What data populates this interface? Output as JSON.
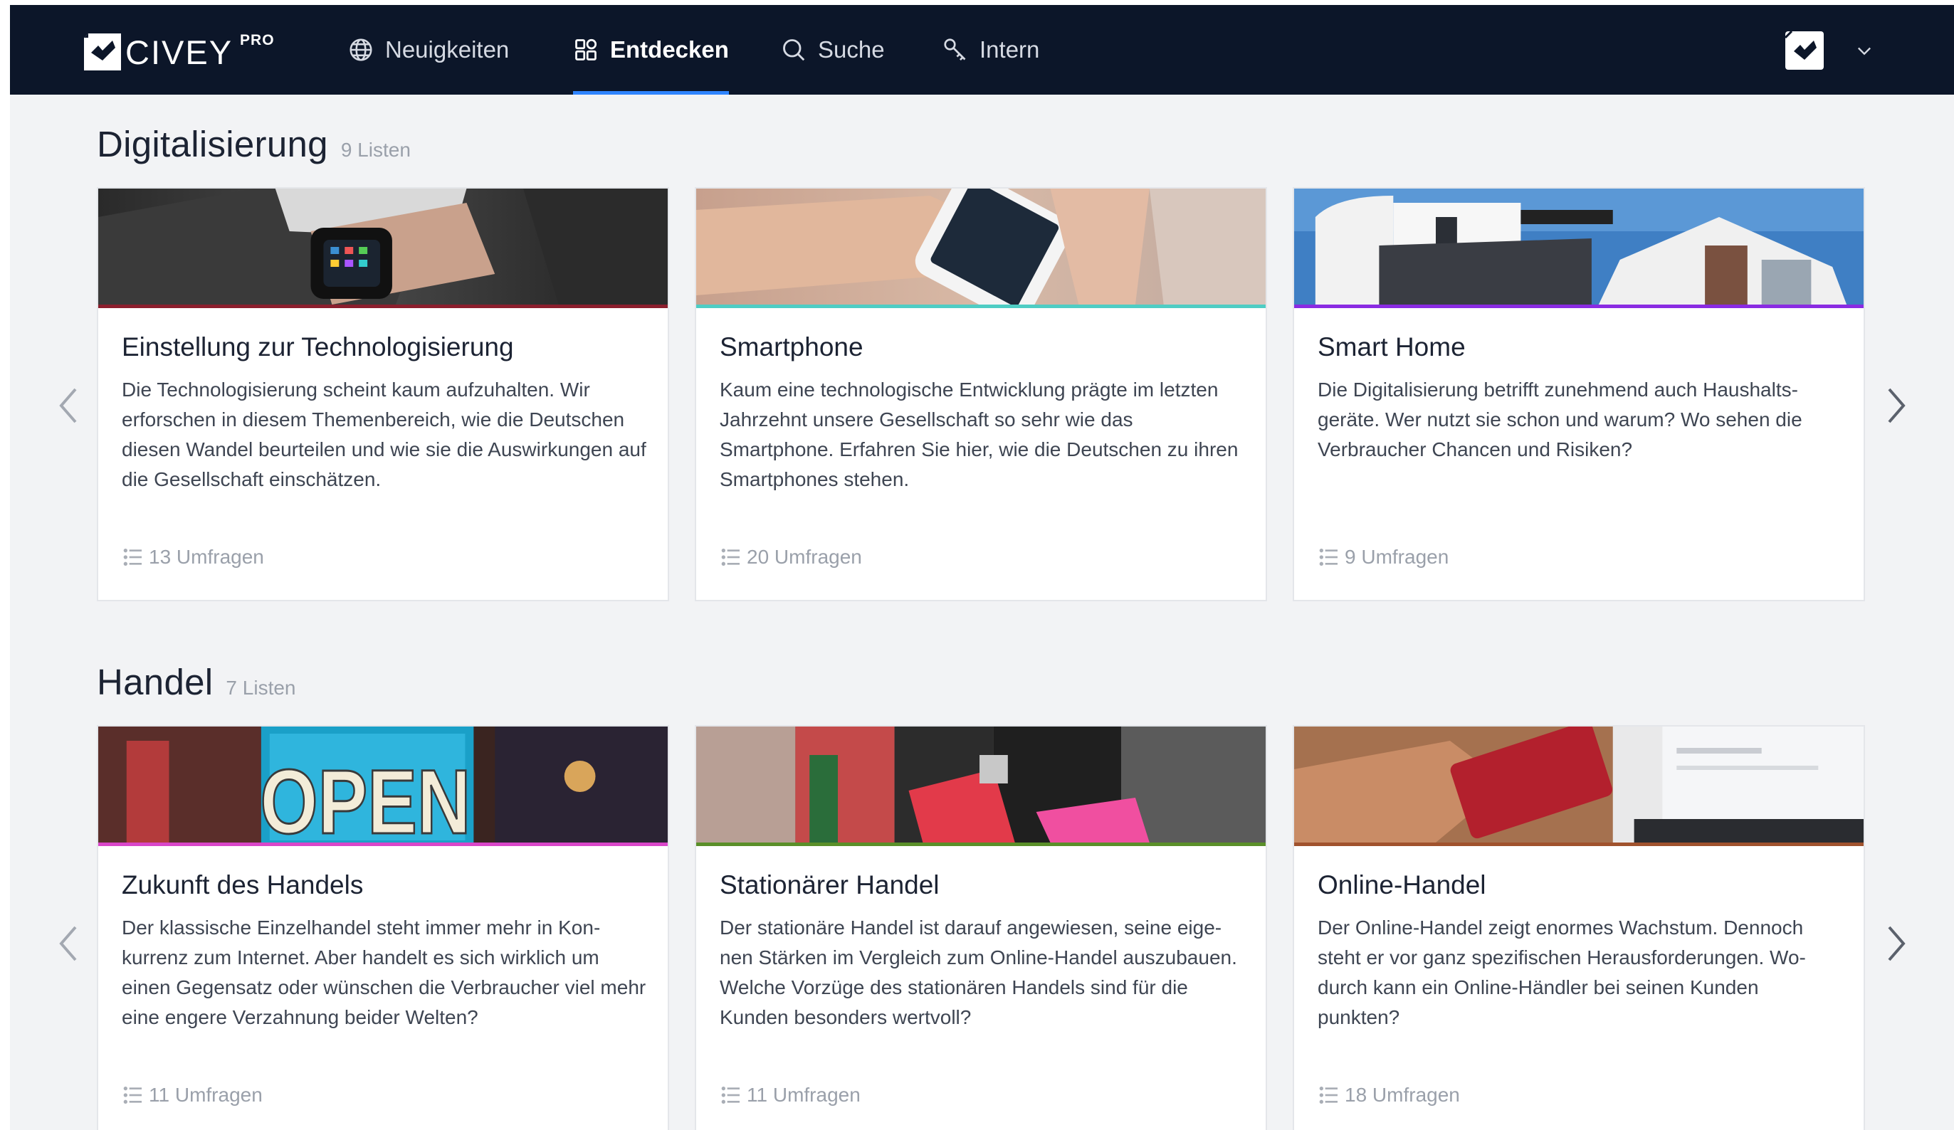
{
  "brand": {
    "name": "CIVEY",
    "badge": "PRO"
  },
  "nav": {
    "items": [
      {
        "label": "Neuigkeiten",
        "icon": "globe-icon"
      },
      {
        "label": "Entdecken",
        "icon": "grid-icon",
        "active": true
      },
      {
        "label": "Suche",
        "icon": "search-icon"
      },
      {
        "label": "Intern",
        "icon": "key-icon"
      }
    ],
    "accent": "#2f84ff"
  },
  "sections": [
    {
      "title": "Digitalisierung",
      "count": "9 Listen",
      "cards": [
        {
          "title": "Einstellung zur Technologisierung",
          "description": "Die Technologisierung scheint kaum aufzuhalten. Wir erforschen in diesem Themenbereich, wie die Deut­schen diesen Wandel beurteilen und wie sie die Auswir­kungen auf die Gesellschaft einschätzen.",
          "surveys": "13 Umfragen",
          "accent": "#8b1e2d",
          "image": "smartwatch-photo"
        },
        {
          "title": "Smartphone",
          "description": "Kaum eine technologische Entwicklung prägte im letz­ten Jahrzehnt unsere Gesellschaft so sehr wie das Smartphone. Erfahren Sie hier, wie die Deutschen zu ih­ren Smartphones stehen.",
          "surveys": "20 Umfragen",
          "accent": "#4ecdc4",
          "image": "smartphone-photo"
        },
        {
          "title": "Smart Home",
          "description": "Die Digitalisierung betrifft zunehmend auch Haushalts­geräte. Wer nutzt sie schon und warum? Wo sehen die Verbraucher Chancen und Risiken?",
          "surveys": "9 Umfragen",
          "accent": "#8a2be2",
          "image": "house-photo"
        }
      ]
    },
    {
      "title": "Handel",
      "count": "7 Listen",
      "cards": [
        {
          "title": "Zukunft des Handels",
          "description": "Der klassische Einzelhandel steht immer mehr in Kon­kurrenz zum Internet. Aber handelt es sich wirklich um einen Gegensatz oder wünschen die Verbraucher viel mehr eine engere Verzahnung beider Welten?",
          "surveys": "11 Umfragen",
          "accent": "#d946c9",
          "image": "open-sign-photo",
          "sign": "OPEN"
        },
        {
          "title": "Stationärer Handel",
          "description": "Der stationäre Handel ist darauf angewiesen, seine eige­nen Stärken im Vergleich zum Online-Handel auszubau­en. Welche Vorzüge des stationären Handels sind für die Kunden besonders wertvoll?",
          "surveys": "11 Umfragen",
          "accent": "#5a8f29",
          "image": "shopping-bags-photo"
        },
        {
          "title": "Online-Handel",
          "description": "Der Online-Handel zeigt enormes Wachstum. Dennoch steht er vor ganz spezifischen Herausforderungen. Wo­durch kann ein Online-Händler bei seinen Kunden punkten?",
          "surveys": "18 Umfragen",
          "accent": "#a0522d",
          "image": "credit-card-photo"
        }
      ]
    }
  ]
}
